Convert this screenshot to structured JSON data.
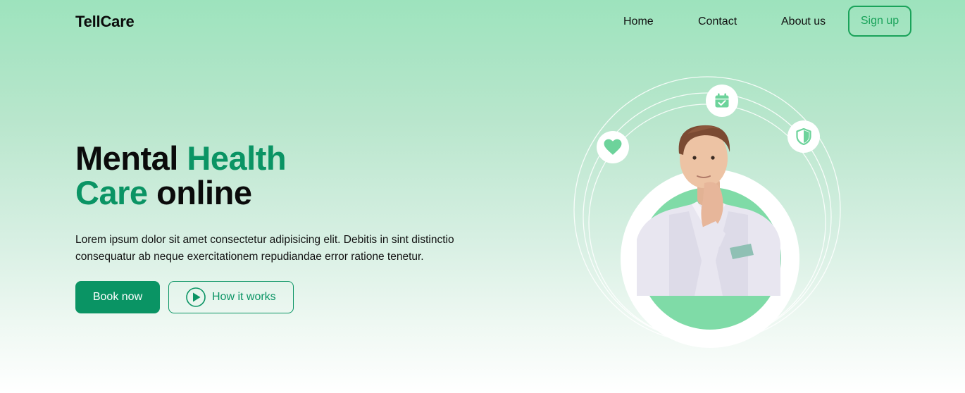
{
  "nav": {
    "logo": "TellCare",
    "links": [
      "Home",
      "Contact",
      "About us"
    ],
    "signup_label": "Sign up"
  },
  "hero": {
    "title_part1": "Mental ",
    "title_accent1": "Health",
    "title_accent2": "Care",
    "title_part2": " online",
    "description": "Lorem ipsum dolor sit amet consectetur adipisicing elit. Debitis in sint distinctio consequatur ab neque exercitationem repudiandae error ratione tenetur.",
    "book_label": "Book now",
    "how_label": "How it works"
  },
  "illustration": {
    "icons": [
      "heart-icon",
      "calendar-check-icon",
      "shield-check-icon"
    ],
    "subject": "man-portrait"
  },
  "colors": {
    "accent": "#0a9464",
    "signup_border": "#1aa35a",
    "circle_fill": "#7fdba7",
    "icon_green": "#6dd39b"
  }
}
